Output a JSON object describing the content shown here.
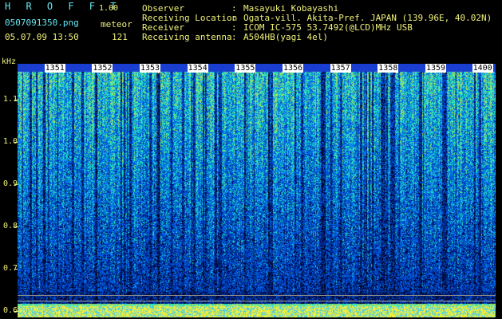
{
  "header": {
    "app_title": "H R O F F T",
    "app_version": "1.00",
    "file_name": "0507091350.png",
    "meteor_label": "meteor",
    "datetime": "05.07.09 13:50",
    "meteor_count": "121"
  },
  "info": [
    {
      "key": "Observer",
      "sep": ":",
      "value": "Masayuki Kobayashi"
    },
    {
      "key": "Receiving Location",
      "sep": ":",
      "value": "Ogata-vill. Akita-Pref. JAPAN (139.96E, 40.02N)"
    },
    {
      "key": "Receiver",
      "sep": ":",
      "value": "ICOM IC-575 53.7492(@LCD)MHz USB"
    },
    {
      "key": "Receiving antenna",
      "sep": ":",
      "value": "A504HB(yagi 4el)"
    }
  ],
  "y_axis": {
    "unit_label": "kHz",
    "ticks": [
      {
        "label": "1.1",
        "value": 1.1
      },
      {
        "label": "1.0",
        "value": 1.0
      },
      {
        "label": "0.9",
        "value": 0.9
      },
      {
        "label": "0.8",
        "value": 0.8
      },
      {
        "label": "0.7",
        "value": 0.7
      },
      {
        "label": "0.6",
        "value": 0.6
      }
    ],
    "range": [
      0.585,
      1.185
    ]
  },
  "x_axis": {
    "ticks": [
      "1351",
      "1352",
      "1353",
      "1354",
      "1355",
      "1356",
      "1357",
      "1358",
      "1359",
      "1400"
    ],
    "range_minutes": [
      0,
      10
    ]
  },
  "colors": {
    "background": "#000000",
    "text_yellow": "#f0f07a",
    "text_cyan": "#66e6f0",
    "spectro_low": "#00107a",
    "spectro_mid": "#1e64ff",
    "spectro_high": "#3cf0a0",
    "spectro_peak": "#f0f050"
  }
}
